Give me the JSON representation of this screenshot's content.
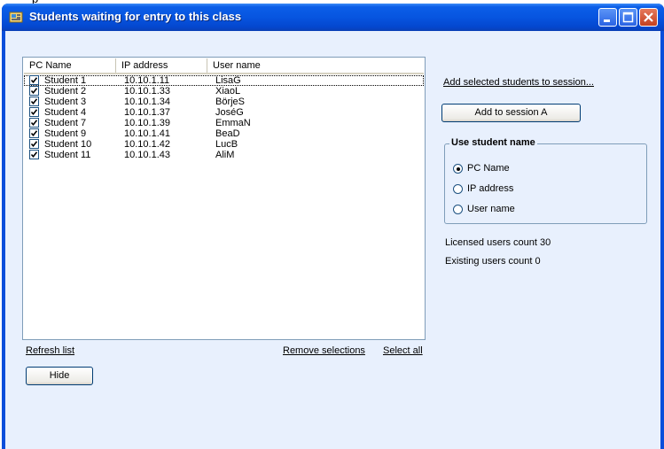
{
  "window": {
    "title": "Students waiting for entry to this class",
    "partial_top_text": "p"
  },
  "list": {
    "columns": [
      "PC Name",
      "IP address",
      "User name"
    ],
    "rows": [
      {
        "pc": "Student  1",
        "ip": "10.10.1.11",
        "user": "LisaG",
        "checked": true
      },
      {
        "pc": "Student  2",
        "ip": "10.10.1.33",
        "user": "XiaoL",
        "checked": true
      },
      {
        "pc": "Student  3",
        "ip": "10.10.1.34",
        "user": "BörjeS",
        "checked": true
      },
      {
        "pc": "Student  4",
        "ip": "10.10.1.37",
        "user": "JoséG",
        "checked": true
      },
      {
        "pc": "Student  7",
        "ip": "10.10.1.39",
        "user": "EmmaN",
        "checked": true
      },
      {
        "pc": "Student  9",
        "ip": "10.10.1.41",
        "user": "BeaD",
        "checked": true
      },
      {
        "pc": "Student  10",
        "ip": "10.10.1.42",
        "user": "LucB",
        "checked": true
      },
      {
        "pc": "Student  11",
        "ip": "10.10.1.43",
        "user": "AliM",
        "checked": true
      }
    ]
  },
  "links": {
    "refresh": "Refresh list",
    "remove_selections": "Remove selections",
    "select_all": "Select all",
    "add_selected": "Add selected students to session..."
  },
  "buttons": {
    "hide": "Hide",
    "add_to_session": "Add to session A"
  },
  "use_student_name": {
    "title": "Use student name",
    "options": [
      {
        "label": "PC Name",
        "selected": true
      },
      {
        "label": "IP address",
        "selected": false
      },
      {
        "label": "User name",
        "selected": false
      }
    ]
  },
  "stats": {
    "licensed": "Licensed users count 30",
    "existing": "Existing users count 0"
  },
  "colors": {
    "titlebar": "#0755e0",
    "client_background": "#e8f0fd",
    "list_border": "#7f9db9"
  }
}
